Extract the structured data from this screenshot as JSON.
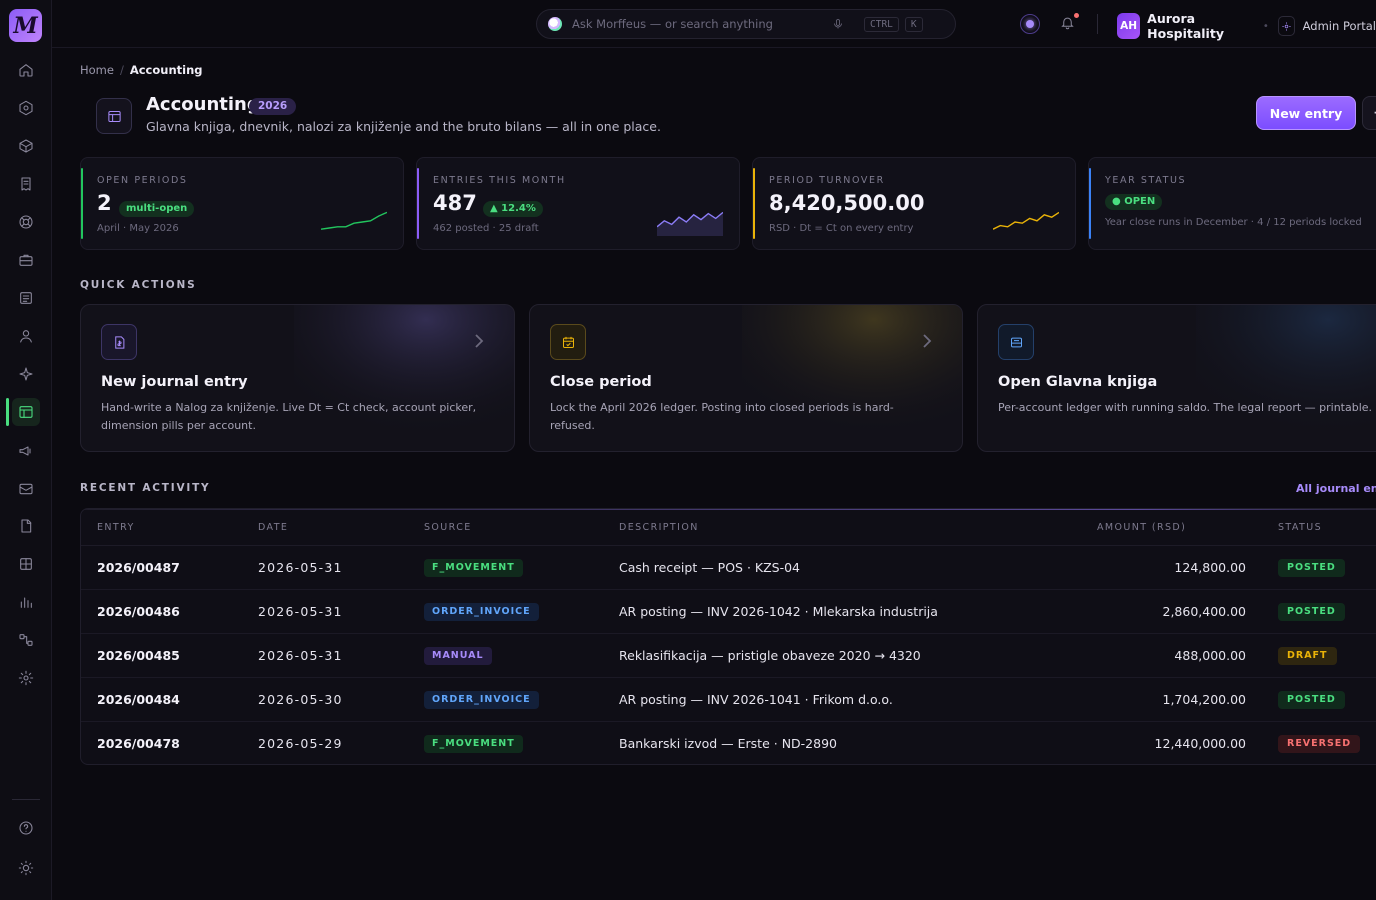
{
  "app": {
    "logo_letter": "M"
  },
  "sidebar": {
    "items": [
      {
        "icon": "home-icon"
      },
      {
        "icon": "hexagon-icon"
      },
      {
        "icon": "box-icon"
      },
      {
        "icon": "receipt-icon"
      },
      {
        "icon": "lifebuoy-icon"
      },
      {
        "icon": "briefcase-icon"
      },
      {
        "icon": "document-icon"
      },
      {
        "icon": "user-icon"
      },
      {
        "icon": "sparkle-icon"
      },
      {
        "icon": "accounting-icon"
      },
      {
        "icon": "megaphone-icon"
      },
      {
        "icon": "tickets-icon"
      },
      {
        "icon": "file-icon"
      },
      {
        "icon": "grid-icon"
      },
      {
        "icon": "bar-chart-icon"
      },
      {
        "icon": "workflow-icon"
      },
      {
        "icon": "settings-icon"
      },
      {
        "icon": "help-icon"
      },
      {
        "icon": "theme-icon"
      }
    ]
  },
  "topbar": {
    "search_placeholder": "Ask Morffeus — or search anything",
    "kbd_ctrl": "CTRL",
    "kbd_k": "K",
    "org_initials": "AH",
    "org_name": "Aurora Hospitality",
    "portal_label": "Admin Portal"
  },
  "breadcrumb": {
    "home": "Home",
    "separator": "/",
    "current": "Accounting"
  },
  "header": {
    "title": "Accounting",
    "year": "2026",
    "subtitle": "Glavna knjiga, dnevnik, nalozi za knjiženje and the bruto bilans — all in one place.",
    "new_entry_label": "New entry",
    "more_label": "⋯"
  },
  "stats": [
    {
      "label": "OPEN PERIODS",
      "value": "2",
      "pill": "multi-open",
      "foot": "April · May 2026",
      "accent": "#22c55e",
      "spark": [
        0.2,
        0.25,
        0.3,
        0.3,
        0.45,
        0.5,
        0.55,
        0.75,
        0.9
      ]
    },
    {
      "label": "ENTRIES THIS MONTH",
      "value": "487",
      "pill": "▲ 12.4%",
      "foot": "462 posted · 25 draft",
      "accent": "#8b5cf6",
      "spark": [
        0.3,
        0.55,
        0.4,
        0.7,
        0.5,
        0.8,
        0.6,
        0.85,
        0.65,
        0.9
      ]
    },
    {
      "label": "PERIOD TURNOVER",
      "value": "8,420,500.00",
      "foot": "RSD · Dt = Ct on every entry",
      "accent": "#eab308",
      "spark": [
        0.2,
        0.35,
        0.3,
        0.5,
        0.45,
        0.65,
        0.55,
        0.8,
        0.7,
        0.9
      ]
    },
    {
      "label": "YEAR STATUS",
      "pill": "● OPEN",
      "foot": "Year close runs in December · 4 / 12 periods locked",
      "accent": "#3b82f6"
    }
  ],
  "quick_actions": {
    "title": "QUICK ACTIONS",
    "items": [
      {
        "title": "New journal entry",
        "desc": "Hand-write a Nalog za knjiženje. Live Dt = Ct check, account picker, dimension pills per account.",
        "icon": "journal-icon"
      },
      {
        "title": "Close period",
        "desc": "Lock the April 2026 ledger. Posting into closed periods is hard-refused.",
        "icon": "calendar-check-icon"
      },
      {
        "title": "Open Glavna knjiga",
        "desc": "Per-account ledger with running saldo. The legal report — printable.",
        "icon": "ledger-icon"
      }
    ]
  },
  "activity": {
    "title": "RECENT ACTIVITY",
    "link": "All journal entries",
    "columns": [
      "ENTRY",
      "DATE",
      "SOURCE",
      "DESCRIPTION",
      "AMOUNT (RSD)",
      "STATUS"
    ],
    "rows": [
      {
        "entry": "2026/00487",
        "date": "2026-05-31",
        "source": "F_MOVEMENT",
        "desc": "Cash receipt — POS · KZS-04",
        "amount": "124,800.00",
        "status": "POSTED"
      },
      {
        "entry": "2026/00486",
        "date": "2026-05-31",
        "source": "ORDER_INVOICE",
        "desc": "AR posting — INV 2026-1042 · Mlekarska industrija",
        "amount": "2,860,400.00",
        "status": "POSTED"
      },
      {
        "entry": "2026/00485",
        "date": "2026-05-31",
        "source": "MANUAL",
        "desc": "Reklasifikacija — pristigle obaveze 2020 → 4320",
        "amount": "488,000.00",
        "status": "DRAFT"
      },
      {
        "entry": "2026/00484",
        "date": "2026-05-30",
        "source": "ORDER_INVOICE",
        "desc": "AR posting — INV 2026-1041 · Frikom d.o.o.",
        "amount": "1,704,200.00",
        "status": "POSTED"
      },
      {
        "entry": "2026/00478",
        "date": "2026-05-29",
        "source": "F_MOVEMENT",
        "desc": "Bankarski izvod — Erste · ND-2890",
        "amount": "12,440,000.00",
        "status": "REVERSED"
      }
    ]
  }
}
